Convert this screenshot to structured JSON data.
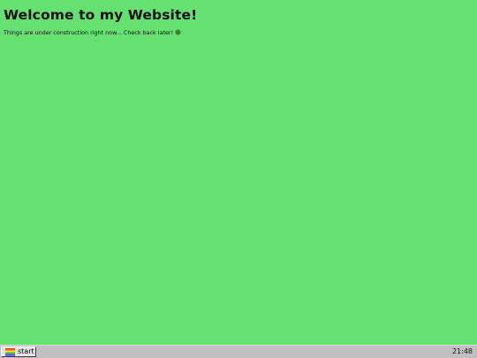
{
  "page": {
    "title": "Welcome to my Website!",
    "message": "Things are under construction right now... Check back later!",
    "message_icon": "construction-icon"
  },
  "taskbar": {
    "start_label": "start",
    "start_icon": "rainbow-logo-icon",
    "clock": "21:48"
  },
  "colors": {
    "background": "#66e070",
    "taskbar": "#c0c0c0"
  }
}
